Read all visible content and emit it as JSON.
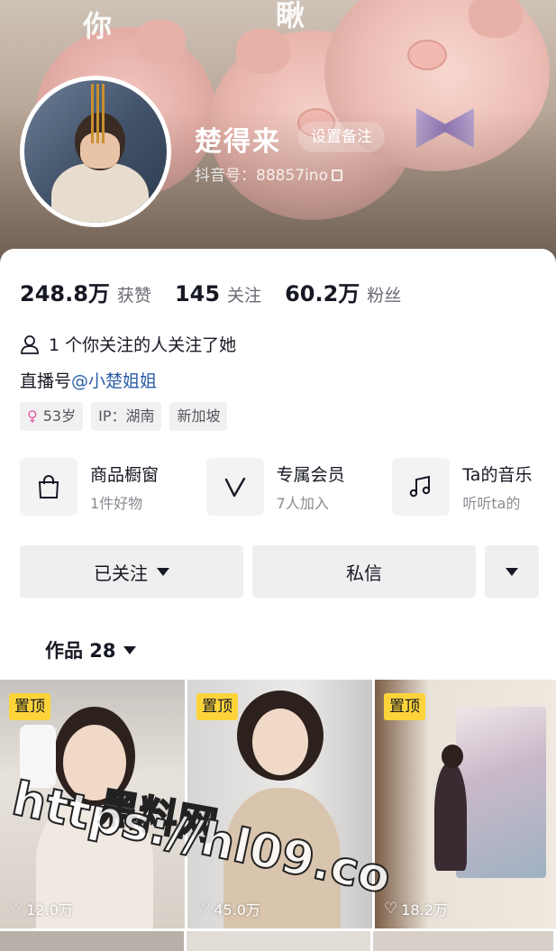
{
  "banner": {
    "chars": [
      "你",
      "瞅"
    ]
  },
  "profile": {
    "nickname": "楚得来",
    "remark_label": "设置备注",
    "douyin_id": "抖音号：88857ino"
  },
  "stats": [
    {
      "value": "248.8万",
      "label": "获赞"
    },
    {
      "value": "145",
      "label": "关注"
    },
    {
      "value": "60.2万",
      "label": "粉丝"
    }
  ],
  "mutual_text": "1 个你关注的人关注了她",
  "live": {
    "prefix": "直播号",
    "handle": "@小楚姐姐"
  },
  "tags": {
    "age": "53岁",
    "ip": "IP：湖南",
    "location": "新加坡"
  },
  "entries": [
    {
      "icon": "shopping-bag-icon",
      "title": "商品橱窗",
      "sub": "1件好物"
    },
    {
      "icon": "v-member-icon",
      "title": "专属会员",
      "sub": "7人加入"
    },
    {
      "icon": "music-note-icon",
      "title": "Ta的音乐",
      "sub": "听听ta的"
    }
  ],
  "actions": {
    "followed": "已关注",
    "message": "私信"
  },
  "works": {
    "label": "作品 28"
  },
  "grid": [
    {
      "pinned": "置顶",
      "likes": "12.0万"
    },
    {
      "pinned": "置顶",
      "likes": "45.0万"
    },
    {
      "pinned": "置顶",
      "likes": "18.2万"
    }
  ],
  "watermark": {
    "line1": "黑料网",
    "line2": "https://hl09.co"
  },
  "colors": {
    "link": "#2b5ea8",
    "pin": "#fcd43a",
    "button_bg": "#efeff0"
  }
}
